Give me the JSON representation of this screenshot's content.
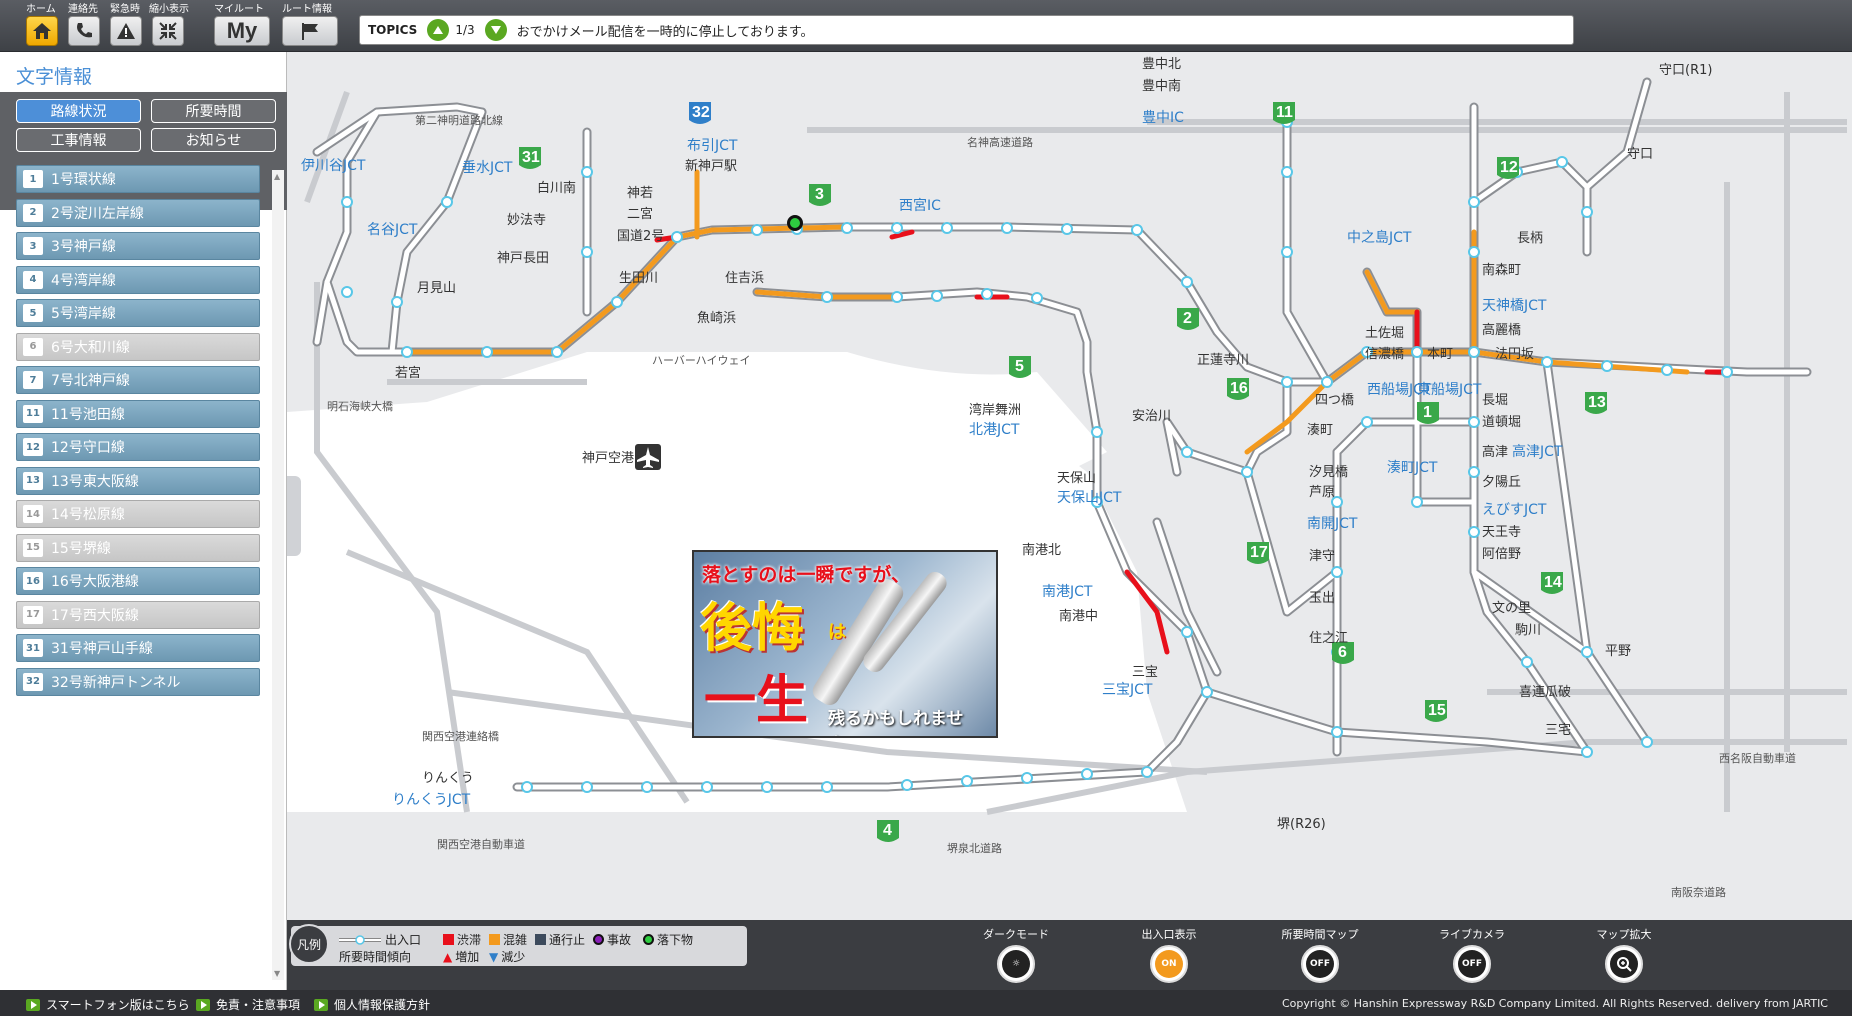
{
  "toolbar": {
    "home_label": "ホーム",
    "contact_label": "連絡先",
    "emergency_label": "緊急時",
    "shrink_label": "縮小表示",
    "myroute_label": "マイルート",
    "myroute_button": "My",
    "routeinfo_label": "ルート情報"
  },
  "topics": {
    "tag": "TOPICS",
    "count": "1/3",
    "message": "おでかけメール配信を一時的に停止しております。"
  },
  "sidebar": {
    "title": "文字情報",
    "tabs": [
      {
        "label": "路線状況",
        "active": true
      },
      {
        "label": "所要時間",
        "active": false
      },
      {
        "label": "工事情報",
        "active": false
      },
      {
        "label": "お知らせ",
        "active": false
      }
    ],
    "routes": [
      {
        "num": "1",
        "name": "1号環状線",
        "enabled": true
      },
      {
        "num": "2",
        "name": "2号淀川左岸線",
        "enabled": true
      },
      {
        "num": "3",
        "name": "3号神戸線",
        "enabled": true
      },
      {
        "num": "4",
        "name": "4号湾岸線",
        "enabled": true
      },
      {
        "num": "5",
        "name": "5号湾岸線",
        "enabled": true
      },
      {
        "num": "6",
        "name": "6号大和川線",
        "enabled": false
      },
      {
        "num": "7",
        "name": "7号北神戸線",
        "enabled": true
      },
      {
        "num": "11",
        "name": "11号池田線",
        "enabled": true
      },
      {
        "num": "12",
        "name": "12号守口線",
        "enabled": true
      },
      {
        "num": "13",
        "name": "13号東大阪線",
        "enabled": true
      },
      {
        "num": "14",
        "name": "14号松原線",
        "enabled": false
      },
      {
        "num": "15",
        "name": "15号堺線",
        "enabled": false
      },
      {
        "num": "16",
        "name": "16号大阪港線",
        "enabled": true
      },
      {
        "num": "17",
        "name": "17号西大阪線",
        "enabled": false
      },
      {
        "num": "31",
        "name": "31号神戸山手線",
        "enabled": true
      },
      {
        "num": "32",
        "name": "32号新神戸トンネル",
        "enabled": true
      }
    ]
  },
  "map": {
    "stations": [
      {
        "name": "伊川谷JCT",
        "blue": true
      },
      {
        "name": "名谷JCT",
        "blue": true
      },
      {
        "name": "垂水JCT",
        "blue": true
      },
      {
        "name": "白川南",
        "blue": false
      },
      {
        "name": "妙法寺",
        "blue": false
      },
      {
        "name": "神戸長田",
        "blue": false
      },
      {
        "name": "月見山",
        "blue": false
      },
      {
        "name": "若宮",
        "blue": false
      },
      {
        "name": "布引JCT",
        "blue": true
      },
      {
        "name": "新神戸駅",
        "blue": false
      },
      {
        "name": "神若",
        "blue": false
      },
      {
        "name": "二宮",
        "blue": false
      },
      {
        "name": "国道2号",
        "blue": false
      },
      {
        "name": "生田川",
        "blue": false
      },
      {
        "name": "住吉浜",
        "blue": false
      },
      {
        "name": "魚崎浜",
        "blue": false
      },
      {
        "name": "西宮IC",
        "blue": true
      },
      {
        "name": "豊中北",
        "blue": false
      },
      {
        "name": "豊中南",
        "blue": false
      },
      {
        "name": "豊中IC",
        "blue": true
      },
      {
        "name": "中之島JCT",
        "blue": true
      },
      {
        "name": "土佐堀",
        "blue": false
      },
      {
        "name": "信濃橋",
        "blue": false
      },
      {
        "name": "本町",
        "blue": false
      },
      {
        "name": "天神橋JCT",
        "blue": true
      },
      {
        "name": "南森町",
        "blue": false
      },
      {
        "name": "高麗橋",
        "blue": false
      },
      {
        "name": "法円坂",
        "blue": false
      },
      {
        "name": "西船場JCT",
        "blue": true
      },
      {
        "name": "東船場JCT",
        "blue": true
      },
      {
        "name": "長堀",
        "blue": false
      },
      {
        "name": "道頓堀",
        "blue": false
      },
      {
        "name": "高津",
        "blue": false
      },
      {
        "name": "高津JCT",
        "blue": true
      },
      {
        "name": "夕陽丘",
        "blue": false
      },
      {
        "name": "えびすJCT",
        "blue": true
      },
      {
        "name": "天王寺",
        "blue": false
      },
      {
        "name": "阿倍野",
        "blue": false
      },
      {
        "name": "湊町JCT",
        "blue": true
      },
      {
        "name": "南開JCT",
        "blue": true
      },
      {
        "name": "四つ橋",
        "blue": false
      },
      {
        "name": "湊町",
        "blue": false
      },
      {
        "name": "汐見橋",
        "blue": false
      },
      {
        "name": "芦原",
        "blue": false
      },
      {
        "name": "津守",
        "blue": false
      },
      {
        "name": "玉出",
        "blue": false
      },
      {
        "name": "住之江",
        "blue": false
      },
      {
        "name": "正蓮寺川",
        "blue": false
      },
      {
        "name": "安治川",
        "blue": false
      },
      {
        "name": "天保山",
        "blue": false
      },
      {
        "name": "天保山JCT",
        "blue": true
      },
      {
        "name": "湾岸舞洲",
        "blue": false
      },
      {
        "name": "北港JCT",
        "blue": true
      },
      {
        "name": "南港北",
        "blue": false
      },
      {
        "name": "南港JCT",
        "blue": true
      },
      {
        "name": "南港中",
        "blue": false
      },
      {
        "name": "三宝",
        "blue": false
      },
      {
        "name": "三宝JCT",
        "blue": true
      },
      {
        "name": "守口(R1)",
        "blue": false
      },
      {
        "name": "守口",
        "blue": false
      },
      {
        "name": "長柄",
        "blue": false
      },
      {
        "name": "文の里",
        "blue": false
      },
      {
        "name": "駒川",
        "blue": false
      },
      {
        "name": "平野",
        "blue": false
      },
      {
        "name": "喜連瓜破",
        "blue": false
      },
      {
        "name": "三宅",
        "blue": false
      },
      {
        "name": "堺(R26)",
        "blue": false
      },
      {
        "name": "りんくう",
        "blue": false
      },
      {
        "name": "りんくうJCT",
        "blue": true
      },
      {
        "name": "神戸空港",
        "blue": false
      },
      {
        "name": "ハーバーハイウェイ",
        "blue": false
      },
      {
        "name": "名神高速道路",
        "blue": false
      },
      {
        "name": "明石海峡大橋",
        "blue": false
      },
      {
        "name": "関西空港連絡橋",
        "blue": false
      },
      {
        "name": "関西空港自動車道",
        "blue": false
      },
      {
        "name": "堺泉北道路",
        "blue": false
      },
      {
        "name": "南阪奈道路",
        "blue": false
      },
      {
        "name": "西名阪自動車道",
        "blue": false
      },
      {
        "name": "第二神明道路北線",
        "blue": false
      }
    ]
  },
  "ad": {
    "line1": "落とすのは一瞬ですが、",
    "big1": "後悔",
    "small": "は",
    "big2": "一生",
    "line3": "残るかもしれません。"
  },
  "legend": {
    "title": "凡例",
    "entrance": "出入口",
    "congestion": "渋滞",
    "crowded": "混雑",
    "closed": "通行止",
    "accident": "事故",
    "debris": "落下物",
    "trend": "所要時間傾向",
    "increase": "増加",
    "decrease": "減少"
  },
  "controls": {
    "dark_label": "ダークモード",
    "entrance_label": "出入口表示",
    "entrance_state": "ON",
    "timemap_label": "所要時間マップ",
    "timemap_state": "OFF",
    "camera_label": "ライブカメラ",
    "camera_state": "OFF",
    "zoom_label": "マップ拡大"
  },
  "footer": {
    "smartphone": "スマートフォン版はこちら",
    "disclaimer": "免責・注意事項",
    "privacy": "個人情報保護方針",
    "copyright": "Copyright © Hanshin Expressway R&D Company Limited. All Rights Reserved. delivery from JARTIC"
  },
  "colors": {
    "congestion": "#e8101b",
    "crowded": "#f39a1e",
    "closed": "#3c4a5c",
    "accent_blue": "#4d8fd8",
    "shield_green": "#3aa84a"
  }
}
